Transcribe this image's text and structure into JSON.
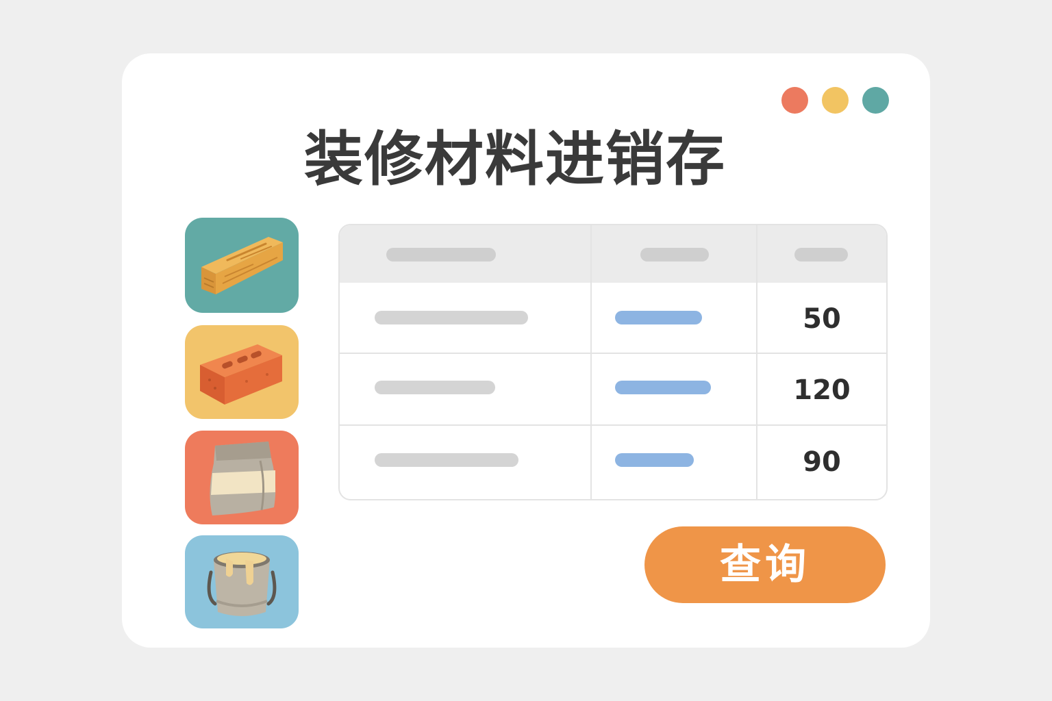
{
  "app": {
    "title": "装修材料进销存"
  },
  "window_controls": {
    "colors": [
      "#ec7a5f",
      "#f2c462",
      "#5fa8a4"
    ]
  },
  "materials": [
    {
      "icon": "wood-plank-icon",
      "bg": "#62aaa5"
    },
    {
      "icon": "brick-icon",
      "bg": "#f2c46b"
    },
    {
      "icon": "cement-bag-icon",
      "bg": "#ee7b5c"
    },
    {
      "icon": "paint-bucket-icon",
      "bg": "#8cc4dc"
    }
  ],
  "table": {
    "rows": [
      {
        "quantity": "50"
      },
      {
        "quantity": "120"
      },
      {
        "quantity": "90"
      }
    ]
  },
  "actions": {
    "query_label": "查询",
    "query_color": "#ef9548"
  }
}
